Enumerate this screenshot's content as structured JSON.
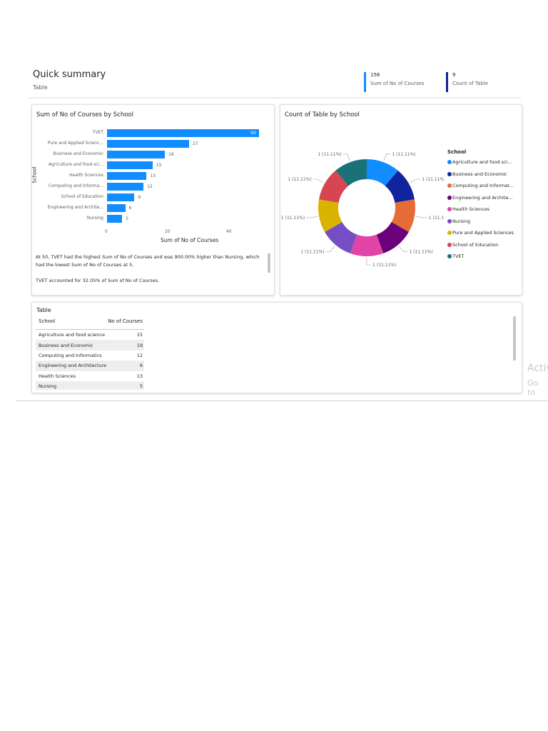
{
  "header": {
    "title": "Quick summary",
    "subtitle": "Table"
  },
  "kpis": [
    {
      "value": "156",
      "label": "Sum of No of Courses",
      "color": "#118DFF"
    },
    {
      "value": "9",
      "label": "Count of Table",
      "color": "#12239E"
    }
  ],
  "bar_card": {
    "title": "Sum of No of Courses by School",
    "y_axis_title": "School",
    "x_axis_title": "Sum of No of Courses",
    "x_ticks": [
      "0",
      "20",
      "40"
    ],
    "narrative": [
      "At 50, TVET had the highest Sum of No of Courses and was 900.00% higher than Nursing, which had the lowest Sum of No of Courses at 5.",
      "TVET accounted for 32.05% of Sum of No of Courses."
    ]
  },
  "donut_card": {
    "title": "Count of Table by School",
    "legend_title": "School"
  },
  "chart_data": [
    {
      "type": "bar",
      "title": "Sum of No of Courses by School",
      "xlabel": "Sum of No of Courses",
      "ylabel": "School",
      "xlim": [
        0,
        50
      ],
      "categories": [
        "TVET",
        "Pure and Applied Scienc...",
        "Business and Economic",
        "Agriculture and food sci...",
        "Health Sciences",
        "Computing and Informa...",
        "School of Education",
        "Engineering and Archite...",
        "Nursing"
      ],
      "values": [
        50,
        27,
        19,
        15,
        13,
        12,
        9,
        6,
        5
      ],
      "color": "#118DFF"
    },
    {
      "type": "pie",
      "title": "Count of Table by School",
      "legend_title": "School",
      "categories": [
        "Agriculture and food sci...",
        "Business and Economic",
        "Computing and Informat...",
        "Engineering and Archite...",
        "Health Sciences",
        "Nursing",
        "Pure and Applied Sciences",
        "School of Education",
        "TVET"
      ],
      "values": [
        1,
        1,
        1,
        1,
        1,
        1,
        1,
        1,
        1
      ],
      "labels": [
        "1 (11.11%)",
        "1 (11.11%)",
        "1 (11.11%)",
        "1 (11.11%)",
        "1 (11.11%)",
        "1 (11.11%)",
        "1 (11.11%)",
        "1 (11.11%)",
        "1 (11.11%)"
      ],
      "colors": [
        "#118DFF",
        "#12239E",
        "#E66C37",
        "#6B007B",
        "#E044A7",
        "#744EC2",
        "#D9B300",
        "#D64550",
        "#197278"
      ]
    }
  ],
  "table": {
    "title": "Table",
    "columns": [
      "School",
      "No of Courses"
    ],
    "rows": [
      [
        "Agriculture and food science",
        "15"
      ],
      [
        "Business and Economic",
        "19"
      ],
      [
        "Computing and Informatics",
        "12"
      ],
      [
        "Engineering and Architecture",
        "6"
      ],
      [
        "Health Sciences",
        "13"
      ],
      [
        "Nursing",
        "5"
      ]
    ]
  },
  "watermark": [
    "Activ",
    "Go to"
  ]
}
